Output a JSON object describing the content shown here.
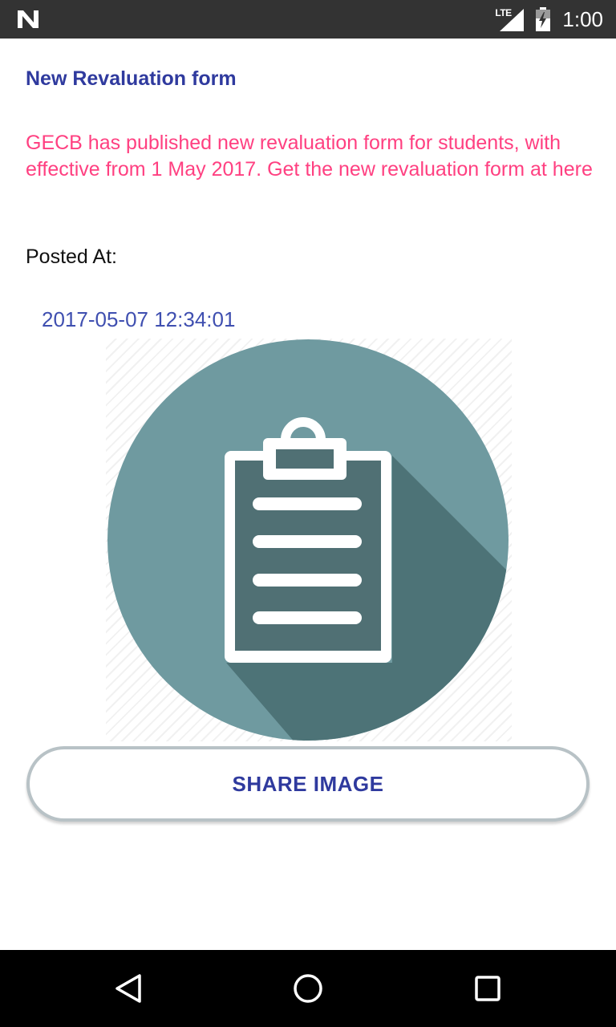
{
  "status_bar": {
    "network_label": "LTE",
    "time": "1:00",
    "icons": [
      "n-logo-icon",
      "signal-icon",
      "battery-icon"
    ]
  },
  "post": {
    "title": "New Revaluation form",
    "message": "GECB has published new revaluation form for students, with effective from 1 May 2017. Get the new revaluation form at here",
    "posted_label": "Posted At:",
    "posted_at": "2017-05-07 12:34:01",
    "image_icon": "clipboard-icon"
  },
  "actions": {
    "share_label": "SHARE IMAGE"
  },
  "nav_bar": {
    "icons": [
      "back-icon",
      "home-icon",
      "recents-icon"
    ]
  },
  "colors": {
    "title": "#2f3a9e",
    "message": "#ff4081",
    "timestamp": "#3f4fb0",
    "circle": "#6f9aa0",
    "clipboard_fill": "#507074",
    "shadow": "#4d7377"
  }
}
